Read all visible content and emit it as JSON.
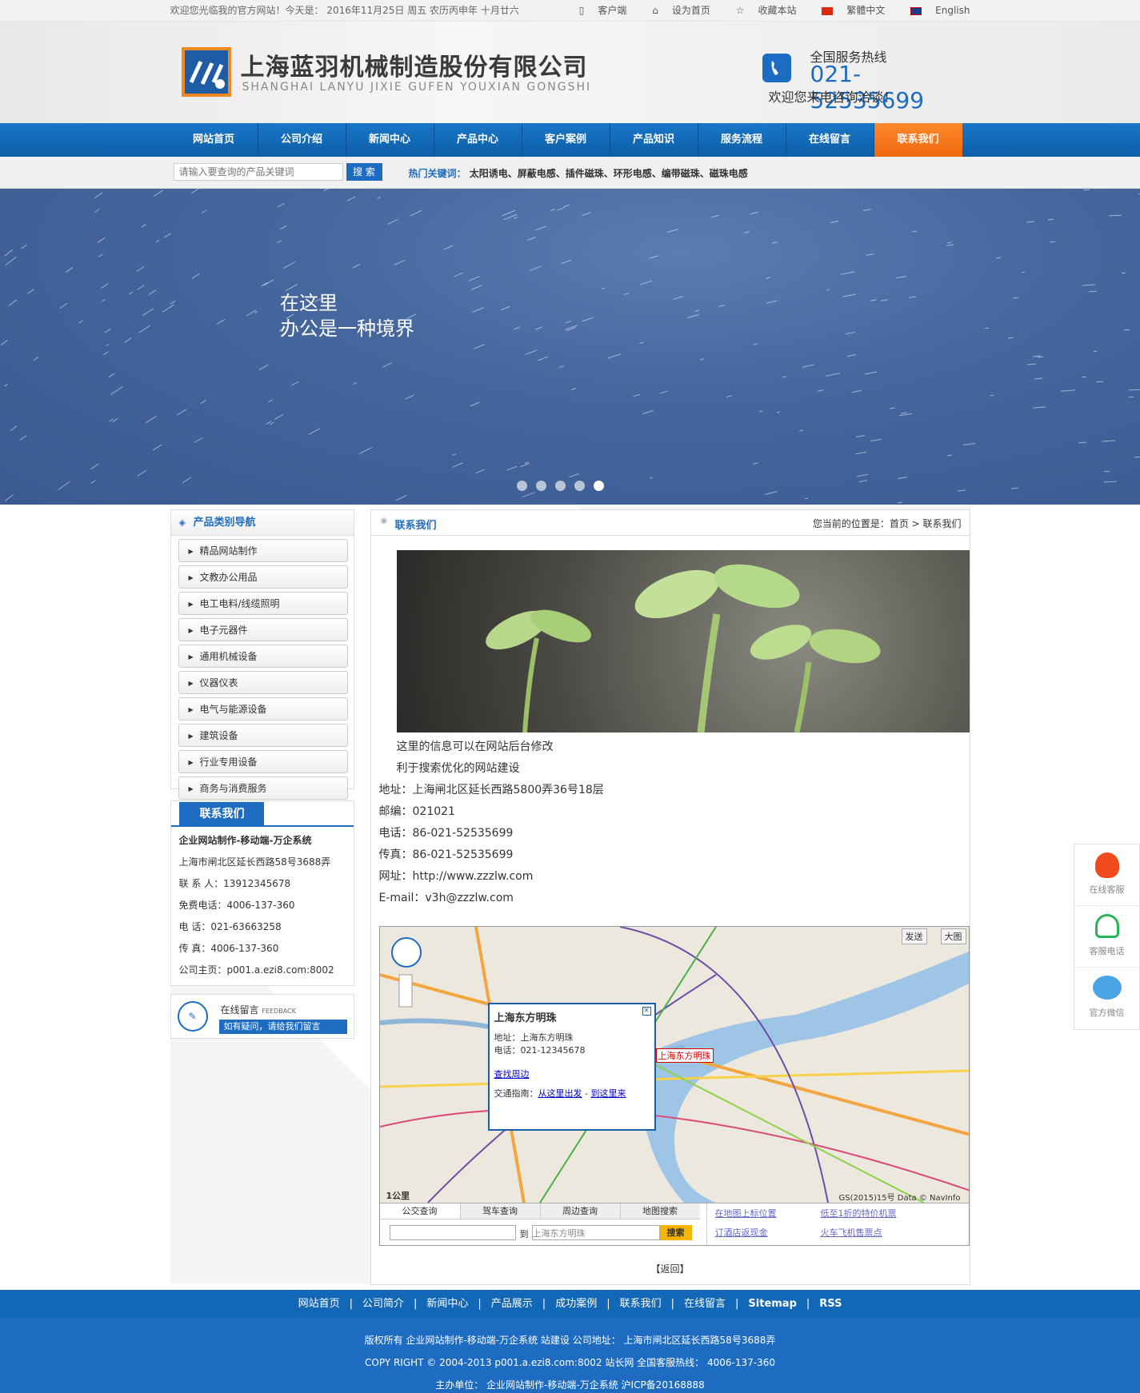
{
  "topbar": {
    "welcome": "欢迎您光临我的官方网站！今天是： 2016年11月25日 周五 农历丙申年 十月廿六",
    "links": [
      "客户端",
      "设为首页",
      "收藏本站",
      "繁體中文",
      "English"
    ]
  },
  "header": {
    "cn": "上海蓝羽机械制造股份有限公司",
    "en": "SHANGHAI LANYU JIXIE GUFEN YOUXIAN GONGSHI",
    "hot1": "全国服务热线",
    "phone": "021-52535699",
    "hot3": "欢迎您来电咨询洽谈！"
  },
  "nav": [
    "网站首页",
    "公司介绍",
    "新闻中心",
    "产品中心",
    "客户案例",
    "产品知识",
    "服务流程",
    "在线留言",
    "联系我们"
  ],
  "search": {
    "placeholder": "请输入要查询的产品关键词",
    "btn": "搜 索",
    "hotlabel": "热门关键词：",
    "hotwords": "太阳诱电、屏蔽电感、插件磁珠、环形电感、编带磁珠、磁珠电感"
  },
  "banner": {
    "line1": "在这里",
    "line2": "办公是一种境界"
  },
  "side": {
    "title": "产品类别导航",
    "cats": [
      "精品网站制作",
      "文教办公用品",
      "电工电料/线缆照明",
      "电子元器件",
      "通用机械设备",
      "仪器仪表",
      "电气与能源设备",
      "建筑设备",
      "行业专用设备",
      "商务与消费服务"
    ],
    "contact": {
      "title": "联系我们",
      "name": "企业网站制作-移动端-万企系统",
      "addr": "上海市闸北区延长西路58号3688弄",
      "person": "联 系 人：13912345678",
      "free": "免费电话：4006-137-360",
      "tel": "电 话：021-63663258",
      "fax": "传 真：4006-137-360",
      "home": "公司主页：p001.a.ezi8.com:8002"
    },
    "msg": {
      "t1": "在线留言",
      "t2": "FEEDBACK",
      "t3": "如有疑问，请给我们留言"
    }
  },
  "content": {
    "title": "联系我们",
    "loc": "您当前的位置是：首页 > 联系我们",
    "p1": "这里的信息可以在网站后台修改",
    "p2": "利于搜索优化的网站建设",
    "addr": "地址：上海闸北区延长西路5800弄36号18层",
    "zip": "邮编：021021",
    "tel": "电话：86-021-52535699",
    "fax": "传真：86-021-52535699",
    "web": "网址：http://www.zzzlw.com",
    "mail": "E-mail：v3h@zzzlw.com",
    "map": {
      "send": "发送",
      "big": "大图",
      "poptitle": "上海东方明珠",
      "popaddr": "地址：上海东方明珠",
      "poptel": "电话：021-12345678",
      "popnear": "查找周边",
      "popguide": "交通指南：",
      "from": "从这里出发",
      "to": "到这里来",
      "marker": "上海东方明珠",
      "scale": "1公里",
      "tabs": [
        "公交查询",
        "驾车查询",
        "周边查询",
        "地图搜索"
      ],
      "dest": "上海东方明珠",
      "go": "搜索",
      "toLabel": "到",
      "links": [
        "在地图上标位置",
        "低至1折的特价机票",
        "订酒店返现金",
        "火车飞机售票点"
      ],
      "copy": "GS(2015)15号  Data © NavInfo"
    },
    "back": "【返回】"
  },
  "fnav": [
    "网站首页",
    "公司简介",
    "新闻中心",
    "产品展示",
    "成功案例",
    "联系我们",
    "在线留言",
    "Sitemap",
    "RSS"
  ],
  "foot": [
    "版权所有 企业网站制作-移动端-万企系统 站建设 公司地址： 上海市闸北区延长西路58号3688弄",
    "COPY RIGHT © 2004-2013 p001.a.ezi8.com:8002 站长网 全国客服热线： 4006-137-360",
    "主办单位： 企业网站制作-移动端-万企系统 沪ICP备20168888"
  ],
  "float": [
    "在线客服",
    "客服电话",
    "官方微信"
  ]
}
